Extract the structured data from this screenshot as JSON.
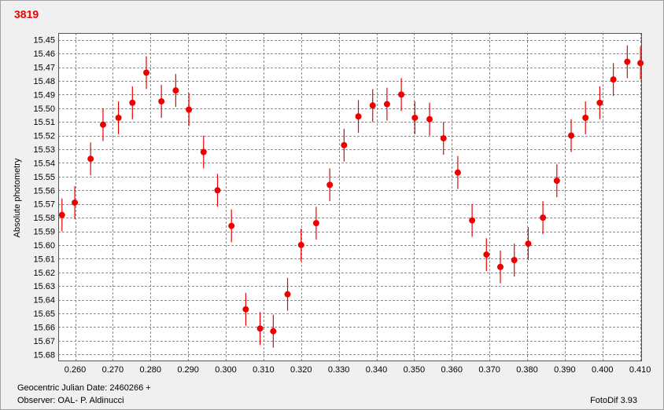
{
  "window": {
    "star_id": "3819"
  },
  "footer": {
    "date_label": "Geocentric Julian Date: 2460266 +",
    "observer_label": "Observer: OAL- P. Aldinucci",
    "software_version": "FotoDif 3.93"
  },
  "colors": {
    "point": "#ee0000",
    "title": "#ee0000",
    "grid": "#8c8c8c",
    "plot_background": "#ffffff"
  },
  "chart_data": {
    "type": "scatter",
    "title": "3819",
    "xlabel": "Geocentric Julian Date: 2460266 +",
    "ylabel": "Absolute photometry",
    "xlim": [
      0.2555,
      0.4105
    ],
    "ylim": [
      15.445,
      15.685
    ],
    "y_inverted": true,
    "grid": true,
    "error_bars": true,
    "x_ticks": [
      0.26,
      0.27,
      0.28,
      0.29,
      0.3,
      0.31,
      0.32,
      0.33,
      0.34,
      0.35,
      0.36,
      0.37,
      0.38,
      0.39,
      0.4,
      0.41
    ],
    "x_tick_labels": [
      "0.260",
      "0.270",
      "0.280",
      "0.290",
      "0.300",
      "0.310",
      "0.320",
      "0.330",
      "0.340",
      "0.350",
      "0.360",
      "0.370",
      "0.380",
      "0.390",
      "0.400",
      "0.410"
    ],
    "y_ticks": [
      15.45,
      15.46,
      15.47,
      15.48,
      15.49,
      15.5,
      15.51,
      15.52,
      15.53,
      15.54,
      15.55,
      15.56,
      15.57,
      15.58,
      15.59,
      15.6,
      15.61,
      15.62,
      15.63,
      15.64,
      15.65,
      15.66,
      15.67,
      15.68
    ],
    "y_tick_labels": [
      "15.45",
      "15.46",
      "15.47",
      "15.48",
      "15.49",
      "15.50",
      "15.51",
      "15.52",
      "15.53",
      "15.54",
      "15.55",
      "15.56",
      "15.57",
      "15.58",
      "15.59",
      "15.60",
      "15.61",
      "15.62",
      "15.63",
      "15.64",
      "15.65",
      "15.66",
      "15.67",
      "15.68"
    ],
    "points": [
      {
        "x": 0.2565,
        "y": 15.578,
        "err": 0.012
      },
      {
        "x": 0.2599,
        "y": 15.569,
        "err": 0.012
      },
      {
        "x": 0.2641,
        "y": 15.537,
        "err": 0.012
      },
      {
        "x": 0.2674,
        "y": 15.512,
        "err": 0.012
      },
      {
        "x": 0.2715,
        "y": 15.507,
        "err": 0.012
      },
      {
        "x": 0.2752,
        "y": 15.496,
        "err": 0.012
      },
      {
        "x": 0.2789,
        "y": 15.474,
        "err": 0.012
      },
      {
        "x": 0.2829,
        "y": 15.495,
        "err": 0.012
      },
      {
        "x": 0.2867,
        "y": 15.487,
        "err": 0.012
      },
      {
        "x": 0.2902,
        "y": 15.501,
        "err": 0.012
      },
      {
        "x": 0.2941,
        "y": 15.532,
        "err": 0.012
      },
      {
        "x": 0.2978,
        "y": 15.56,
        "err": 0.012
      },
      {
        "x": 0.3015,
        "y": 15.586,
        "err": 0.012
      },
      {
        "x": 0.3053,
        "y": 15.647,
        "err": 0.012
      },
      {
        "x": 0.3091,
        "y": 15.661,
        "err": 0.012
      },
      {
        "x": 0.3126,
        "y": 15.663,
        "err": 0.012
      },
      {
        "x": 0.3164,
        "y": 15.636,
        "err": 0.012
      },
      {
        "x": 0.32,
        "y": 15.6,
        "err": 0.012
      },
      {
        "x": 0.324,
        "y": 15.584,
        "err": 0.012
      },
      {
        "x": 0.3276,
        "y": 15.556,
        "err": 0.012
      },
      {
        "x": 0.3314,
        "y": 15.527,
        "err": 0.012
      },
      {
        "x": 0.3352,
        "y": 15.506,
        "err": 0.012
      },
      {
        "x": 0.339,
        "y": 15.498,
        "err": 0.012
      },
      {
        "x": 0.3428,
        "y": 15.497,
        "err": 0.012
      },
      {
        "x": 0.3466,
        "y": 15.49,
        "err": 0.012
      },
      {
        "x": 0.3502,
        "y": 15.507,
        "err": 0.012
      },
      {
        "x": 0.3541,
        "y": 15.508,
        "err": 0.012
      },
      {
        "x": 0.3578,
        "y": 15.522,
        "err": 0.012
      },
      {
        "x": 0.3616,
        "y": 15.547,
        "err": 0.012
      },
      {
        "x": 0.3654,
        "y": 15.582,
        "err": 0.012
      },
      {
        "x": 0.3692,
        "y": 15.607,
        "err": 0.012
      },
      {
        "x": 0.3729,
        "y": 15.616,
        "err": 0.012
      },
      {
        "x": 0.3766,
        "y": 15.611,
        "err": 0.012
      },
      {
        "x": 0.3803,
        "y": 15.599,
        "err": 0.012
      },
      {
        "x": 0.3842,
        "y": 15.58,
        "err": 0.012
      },
      {
        "x": 0.3879,
        "y": 15.553,
        "err": 0.012
      },
      {
        "x": 0.3917,
        "y": 15.52,
        "err": 0.012
      },
      {
        "x": 0.3955,
        "y": 15.507,
        "err": 0.012
      },
      {
        "x": 0.3993,
        "y": 15.496,
        "err": 0.012
      },
      {
        "x": 0.4029,
        "y": 15.479,
        "err": 0.012
      },
      {
        "x": 0.4066,
        "y": 15.466,
        "err": 0.012
      },
      {
        "x": 0.4101,
        "y": 15.467,
        "err": 0.012
      }
    ]
  }
}
